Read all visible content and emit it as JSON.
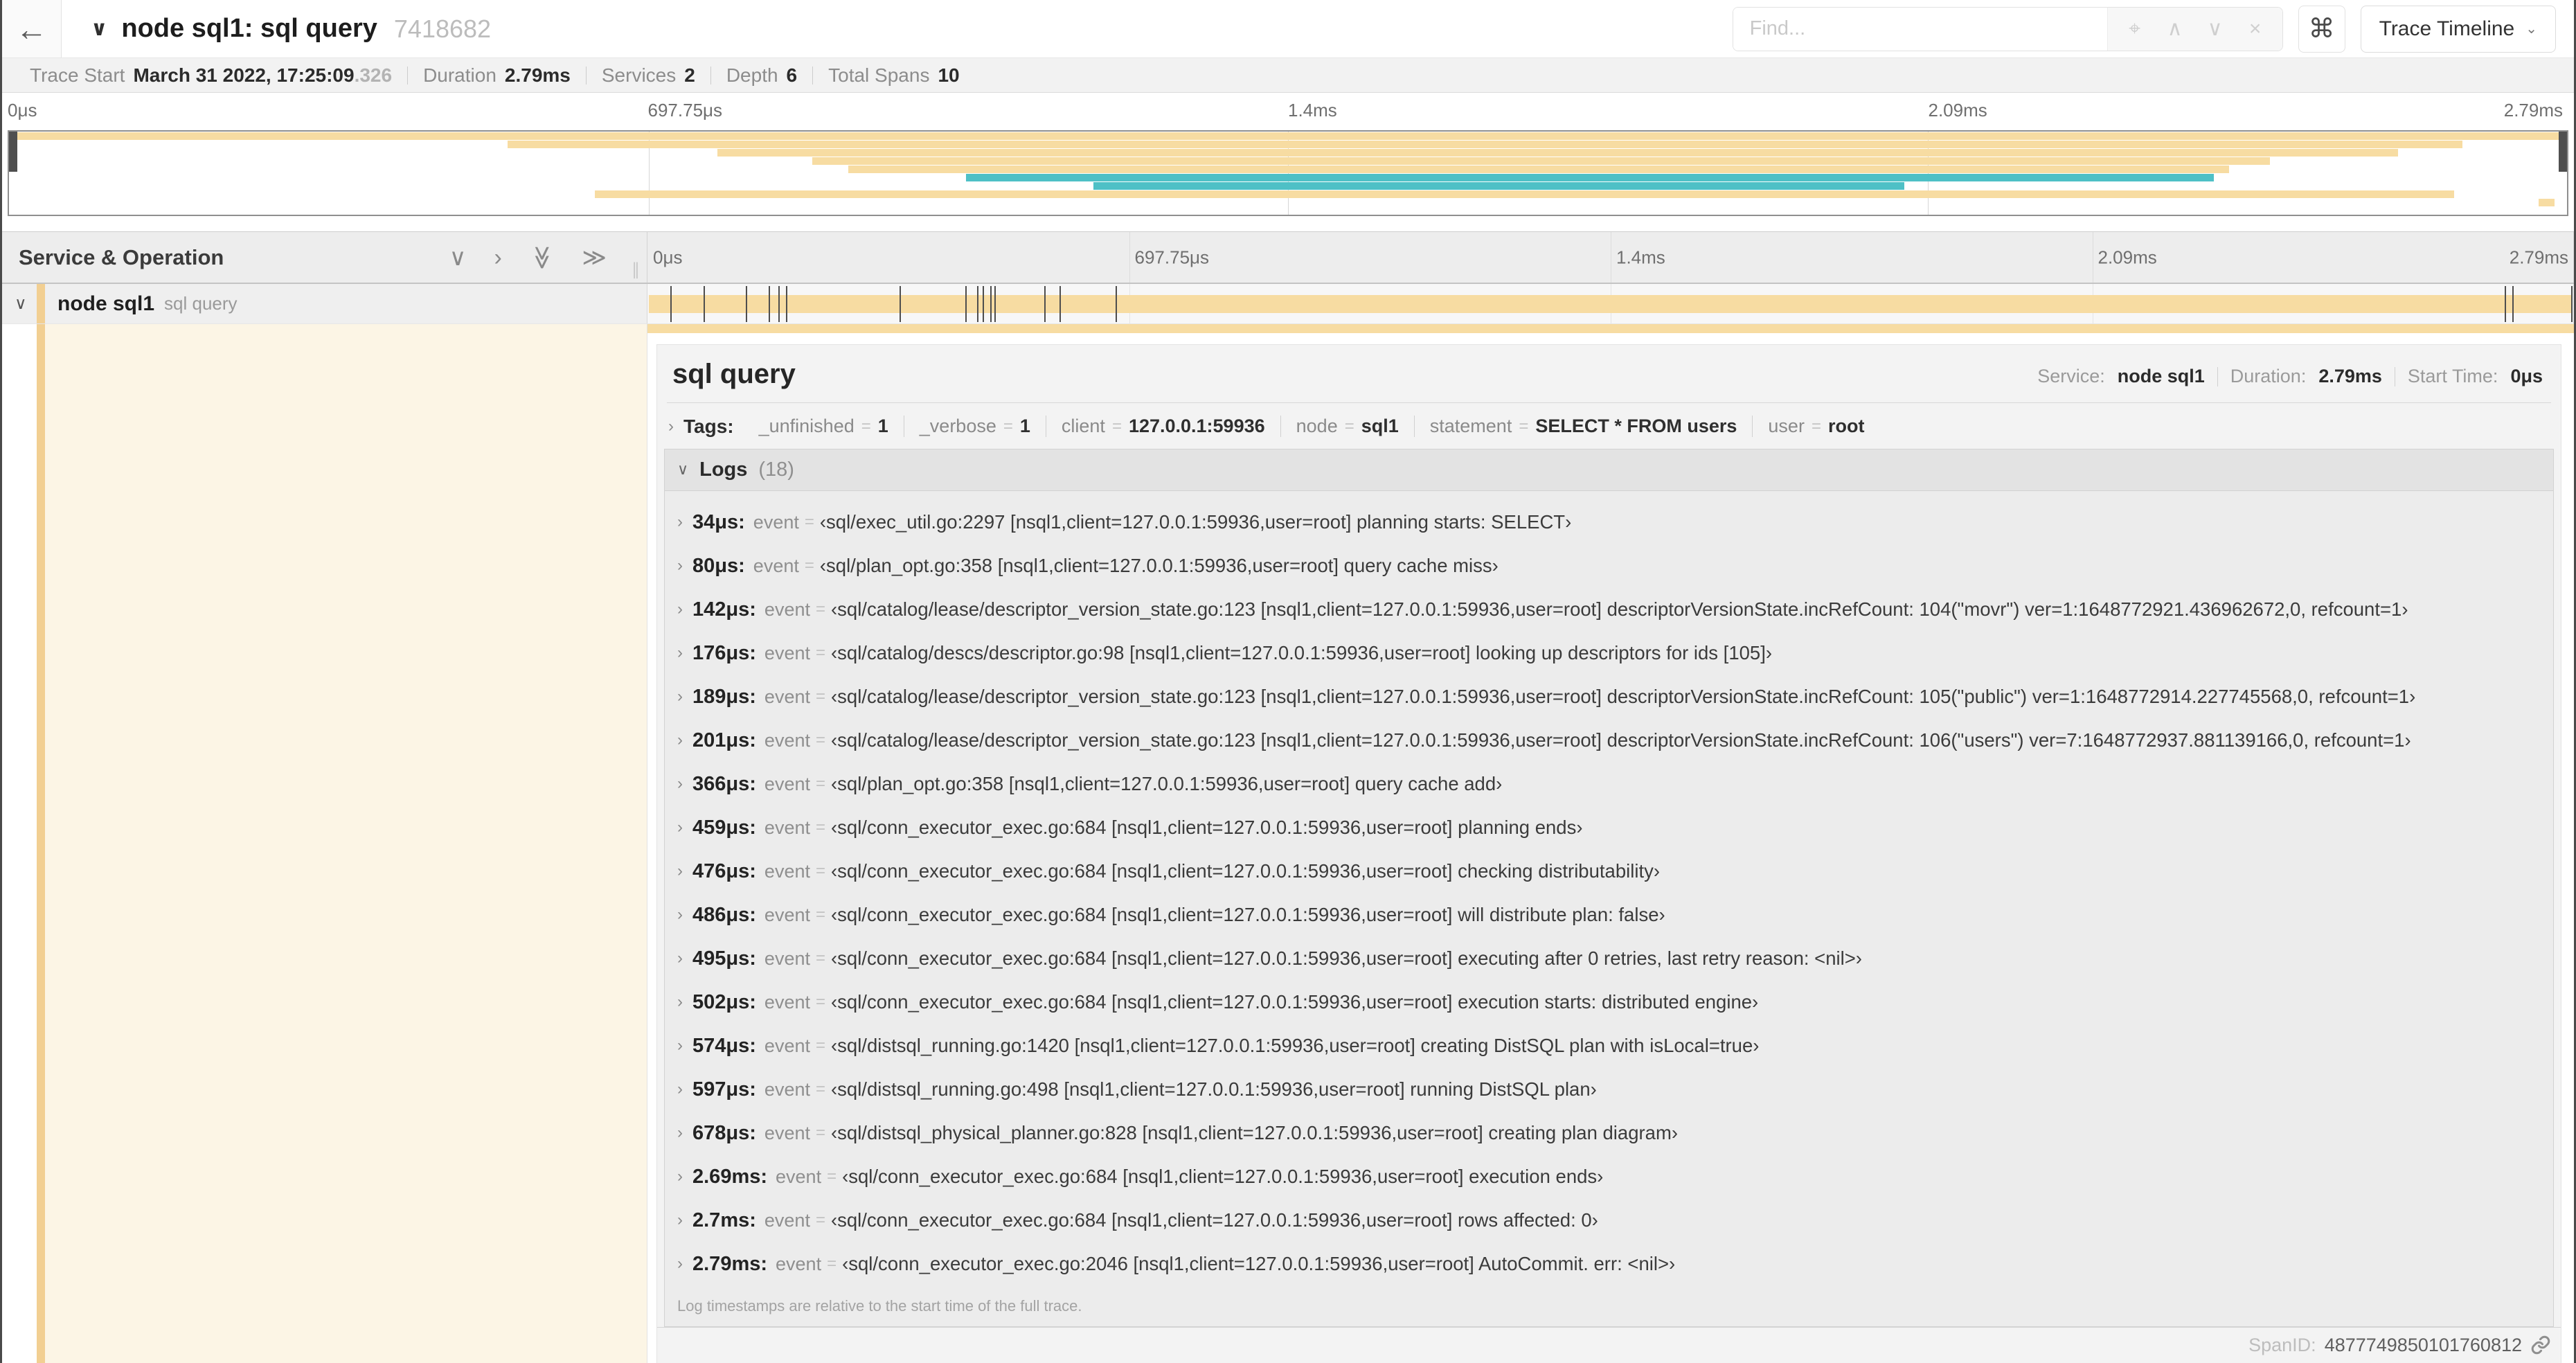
{
  "colors": {
    "tan": "#F7DCA2",
    "tan_dark": "#F2CF92",
    "cream": "#FCF5E5",
    "teal": "#4EC0C6"
  },
  "icons": {
    "back": "←",
    "locate": "⌖",
    "prev": "∧",
    "next": "∨",
    "clear": "×",
    "command": "⌘",
    "dropdown": "⌄",
    "title_chevron": "∨",
    "chevron_down": "∨",
    "chevron_right": "›",
    "double_chevron": "≫",
    "grip": "∥"
  },
  "header": {
    "title": "node sql1: sql query",
    "trace_id": "7418682",
    "find_placeholder": "Find...",
    "view_button": "Trace Timeline"
  },
  "trace_meta": {
    "items": [
      {
        "label": "Trace Start",
        "value": "March 31 2022, 17:25:09",
        "suffix": ".326"
      },
      {
        "label": "Duration",
        "value": "2.79ms"
      },
      {
        "label": "Services",
        "value": "2"
      },
      {
        "label": "Depth",
        "value": "6"
      },
      {
        "label": "Total Spans",
        "value": "10"
      }
    ]
  },
  "timeline": {
    "ticks": [
      {
        "label": "0μs",
        "pos": 0
      },
      {
        "label": "697.75μs",
        "pos": 25
      },
      {
        "label": "1.4ms",
        "pos": 50
      },
      {
        "label": "2.09ms",
        "pos": 75
      },
      {
        "label": "2.79ms",
        "pos": 100
      }
    ],
    "gridlines": [
      25,
      50,
      75,
      100
    ]
  },
  "minimap": {
    "rows": 10,
    "spans": [
      {
        "row": 1,
        "start": 0,
        "end": 100,
        "color": "tan"
      },
      {
        "row": 2,
        "start": 19.5,
        "end": 95.9,
        "color": "tan"
      },
      {
        "row": 3,
        "start": 27.7,
        "end": 93.4,
        "color": "tan"
      },
      {
        "row": 4,
        "start": 31.4,
        "end": 88.4,
        "color": "tan"
      },
      {
        "row": 5,
        "start": 32.8,
        "end": 86.8,
        "color": "tan"
      },
      {
        "row": 6,
        "start": 37.4,
        "end": 86.2,
        "color": "teal"
      },
      {
        "row": 7,
        "start": 42.4,
        "end": 74.1,
        "color": "teal"
      },
      {
        "row": 8,
        "start": 22.9,
        "end": 95.6,
        "color": "tan"
      },
      {
        "row": 9,
        "start": 98.9,
        "end": 99.5,
        "color": "tan"
      }
    ]
  },
  "service_panel": {
    "title": "Service & Operation"
  },
  "span_row": {
    "service": "node sql1",
    "operation": "sql query",
    "log_marks": [
      1.2,
      2.9,
      5.1,
      6.3,
      6.8,
      7.2,
      13.1,
      16.5,
      17.1,
      17.4,
      17.8,
      18.0,
      20.6,
      21.4,
      24.3,
      96.4,
      96.8,
      99.85
    ]
  },
  "detail": {
    "operation": "sql query",
    "service_label": "Service:",
    "service": "node sql1",
    "duration_label": "Duration:",
    "duration": "2.79ms",
    "start_label": "Start Time:",
    "start": "0μs",
    "tags_label": "Tags:",
    "tags": [
      {
        "key": "_unfinished",
        "value": "1"
      },
      {
        "key": "_verbose",
        "value": "1"
      },
      {
        "key": "client",
        "value": "127.0.0.1:59936"
      },
      {
        "key": "node",
        "value": "sql1"
      },
      {
        "key": "statement",
        "value": "SELECT * FROM users"
      },
      {
        "key": "user",
        "value": "root"
      }
    ],
    "logs_label": "Logs",
    "logs_count": "(18)",
    "logs": [
      {
        "time": "34μs:",
        "key": "event",
        "value": "‹sql/exec_util.go:2297 [nsql1,client=127.0.0.1:59936,user=root] planning starts: SELECT›"
      },
      {
        "time": "80μs:",
        "key": "event",
        "value": "‹sql/plan_opt.go:358 [nsql1,client=127.0.0.1:59936,user=root] query cache miss›"
      },
      {
        "time": "142μs:",
        "key": "event",
        "value": "‹sql/catalog/lease/descriptor_version_state.go:123 [nsql1,client=127.0.0.1:59936,user=root] descriptorVersionState.incRefCount: 104(\"movr\") ver=1:1648772921.436962672,0, refcount=1›"
      },
      {
        "time": "176μs:",
        "key": "event",
        "value": "‹sql/catalog/descs/descriptor.go:98 [nsql1,client=127.0.0.1:59936,user=root] looking up descriptors for ids [105]›"
      },
      {
        "time": "189μs:",
        "key": "event",
        "value": "‹sql/catalog/lease/descriptor_version_state.go:123 [nsql1,client=127.0.0.1:59936,user=root] descriptorVersionState.incRefCount: 105(\"public\") ver=1:1648772914.227745568,0, refcount=1›"
      },
      {
        "time": "201μs:",
        "key": "event",
        "value": "‹sql/catalog/lease/descriptor_version_state.go:123 [nsql1,client=127.0.0.1:59936,user=root] descriptorVersionState.incRefCount: 106(\"users\") ver=7:1648772937.881139166,0, refcount=1›"
      },
      {
        "time": "366μs:",
        "key": "event",
        "value": "‹sql/plan_opt.go:358 [nsql1,client=127.0.0.1:59936,user=root] query cache add›"
      },
      {
        "time": "459μs:",
        "key": "event",
        "value": "‹sql/conn_executor_exec.go:684 [nsql1,client=127.0.0.1:59936,user=root] planning ends›"
      },
      {
        "time": "476μs:",
        "key": "event",
        "value": "‹sql/conn_executor_exec.go:684 [nsql1,client=127.0.0.1:59936,user=root] checking distributability›"
      },
      {
        "time": "486μs:",
        "key": "event",
        "value": "‹sql/conn_executor_exec.go:684 [nsql1,client=127.0.0.1:59936,user=root] will distribute plan: false›"
      },
      {
        "time": "495μs:",
        "key": "event",
        "value": "‹sql/conn_executor_exec.go:684 [nsql1,client=127.0.0.1:59936,user=root] executing after 0 retries, last retry reason: <nil>›"
      },
      {
        "time": "502μs:",
        "key": "event",
        "value": "‹sql/conn_executor_exec.go:684 [nsql1,client=127.0.0.1:59936,user=root] execution starts: distributed engine›"
      },
      {
        "time": "574μs:",
        "key": "event",
        "value": "‹sql/distsql_running.go:1420 [nsql1,client=127.0.0.1:59936,user=root] creating DistSQL plan with isLocal=true›"
      },
      {
        "time": "597μs:",
        "key": "event",
        "value": "‹sql/distsql_running.go:498 [nsql1,client=127.0.0.1:59936,user=root] running DistSQL plan›"
      },
      {
        "time": "678μs:",
        "key": "event",
        "value": "‹sql/distsql_physical_planner.go:828 [nsql1,client=127.0.0.1:59936,user=root] creating plan diagram›"
      },
      {
        "time": "2.69ms:",
        "key": "event",
        "value": "‹sql/conn_executor_exec.go:684 [nsql1,client=127.0.0.1:59936,user=root] execution ends›"
      },
      {
        "time": "2.7ms:",
        "key": "event",
        "value": "‹sql/conn_executor_exec.go:684 [nsql1,client=127.0.0.1:59936,user=root] rows affected: 0›"
      },
      {
        "time": "2.79ms:",
        "key": "event",
        "value": "‹sql/conn_executor_exec.go:2046 [nsql1,client=127.0.0.1:59936,user=root] AutoCommit. err: <nil>›"
      }
    ],
    "note": "Log timestamps are relative to the start time of the full trace.",
    "span_id_label": "SpanID:",
    "span_id": "4877749850101760812"
  }
}
